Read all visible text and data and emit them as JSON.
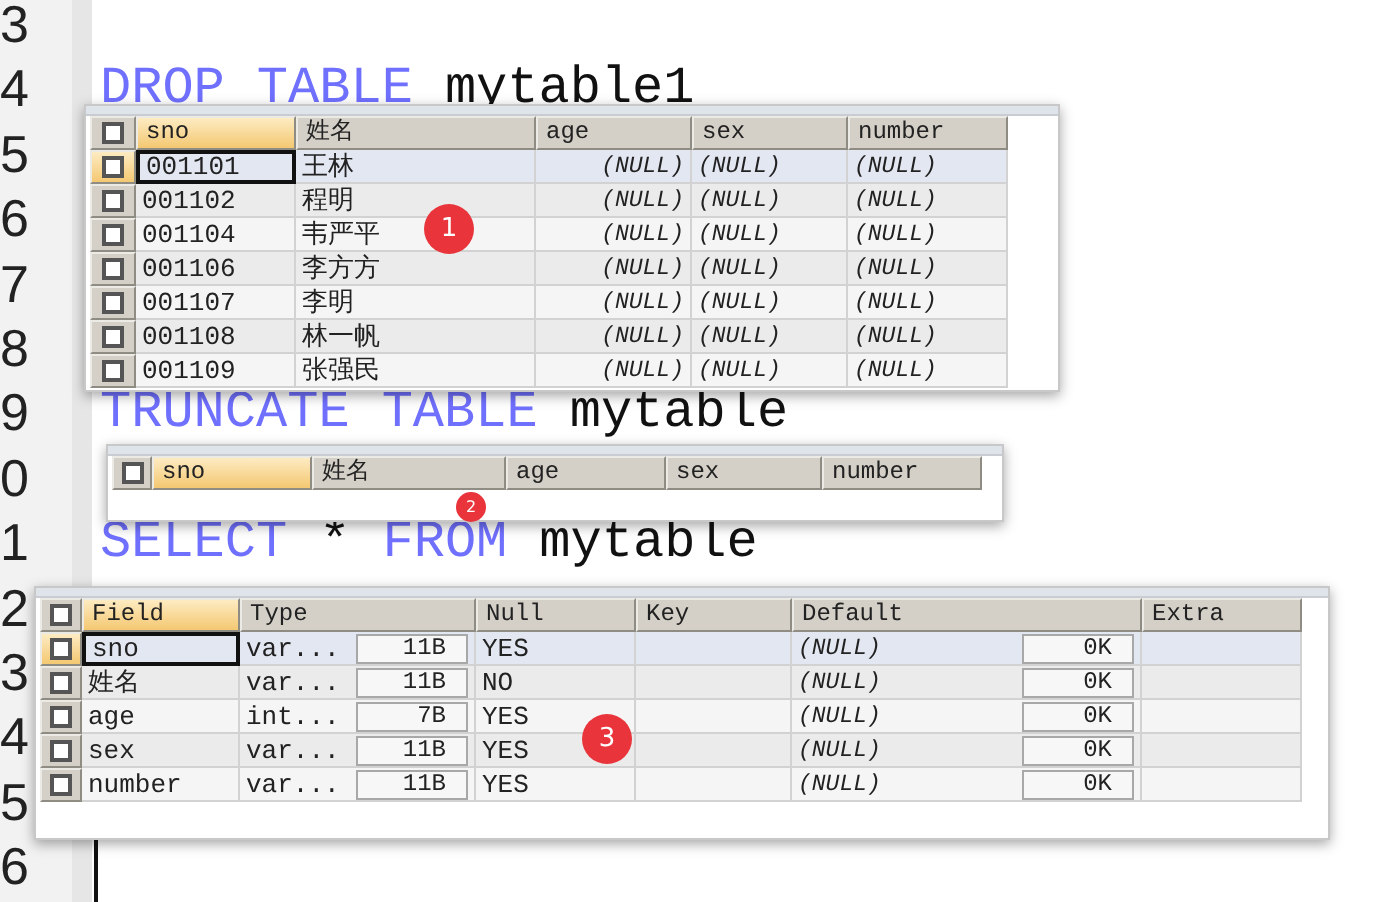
{
  "editor": {
    "lines": [
      {
        "number": "3"
      },
      {
        "number": "4",
        "tokens": [
          {
            "text": "DROP",
            "kind": "keyword"
          },
          {
            "text": "TABLE",
            "kind": "keyword"
          },
          {
            "text": "mytable1",
            "kind": "ident"
          }
        ]
      },
      {
        "number": "5"
      },
      {
        "number": "6"
      },
      {
        "number": "7"
      },
      {
        "number": "8"
      },
      {
        "number": "9",
        "tokens": [
          {
            "text": "TRUNCATE",
            "kind": "keyword"
          },
          {
            "text": "TABLE",
            "kind": "keyword"
          },
          {
            "text": "mytable",
            "kind": "ident"
          }
        ]
      },
      {
        "number": "0"
      },
      {
        "number": "1",
        "tokens": [
          {
            "text": "SELECT",
            "kind": "keyword"
          },
          {
            "text": "*",
            "kind": "ident"
          },
          {
            "text": "FROM",
            "kind": "keyword"
          },
          {
            "text": "mytable",
            "kind": "ident"
          }
        ]
      },
      {
        "number": "2"
      },
      {
        "number": "3"
      },
      {
        "number": "4"
      },
      {
        "number": "5"
      },
      {
        "number": "6"
      }
    ]
  },
  "results": [
    {
      "badge": "1",
      "all_checked": false,
      "columns": [
        {
          "label": "sno",
          "selected": true
        },
        {
          "label": "姓名",
          "selected": false
        },
        {
          "label": "age",
          "selected": false,
          "kind": "numeric"
        },
        {
          "label": "sex",
          "selected": false
        },
        {
          "label": "number",
          "selected": false
        }
      ],
      "rows": [
        {
          "selected": true,
          "checked": false,
          "cells": [
            {
              "text": "001101"
            },
            {
              "text": "王林"
            },
            {
              "text": "(NULL)",
              "null": true
            },
            {
              "text": "(NULL)",
              "null": true
            },
            {
              "text": "(NULL)",
              "null": true
            }
          ]
        },
        {
          "selected": false,
          "checked": false,
          "cells": [
            {
              "text": "001102"
            },
            {
              "text": "程明"
            },
            {
              "text": "(NULL)",
              "null": true
            },
            {
              "text": "(NULL)",
              "null": true
            },
            {
              "text": "(NULL)",
              "null": true
            }
          ]
        },
        {
          "selected": false,
          "checked": false,
          "cells": [
            {
              "text": "001104"
            },
            {
              "text": "韦严平"
            },
            {
              "text": "(NULL)",
              "null": true
            },
            {
              "text": "(NULL)",
              "null": true
            },
            {
              "text": "(NULL)",
              "null": true
            }
          ]
        },
        {
          "selected": false,
          "checked": false,
          "cells": [
            {
              "text": "001106"
            },
            {
              "text": "李方方"
            },
            {
              "text": "(NULL)",
              "null": true
            },
            {
              "text": "(NULL)",
              "null": true
            },
            {
              "text": "(NULL)",
              "null": true
            }
          ]
        },
        {
          "selected": false,
          "checked": false,
          "cells": [
            {
              "text": "001107"
            },
            {
              "text": "李明"
            },
            {
              "text": "(NULL)",
              "null": true
            },
            {
              "text": "(NULL)",
              "null": true
            },
            {
              "text": "(NULL)",
              "null": true
            }
          ]
        },
        {
          "selected": false,
          "checked": false,
          "cells": [
            {
              "text": "001108"
            },
            {
              "text": "林一帆"
            },
            {
              "text": "(NULL)",
              "null": true
            },
            {
              "text": "(NULL)",
              "null": true
            },
            {
              "text": "(NULL)",
              "null": true
            }
          ]
        },
        {
          "selected": false,
          "checked": false,
          "cells": [
            {
              "text": "001109"
            },
            {
              "text": "张强民"
            },
            {
              "text": "(NULL)",
              "null": true
            },
            {
              "text": "(NULL)",
              "null": true
            },
            {
              "text": "(NULL)",
              "null": true
            }
          ]
        }
      ]
    },
    {
      "badge": "2",
      "all_checked": false,
      "columns": [
        {
          "label": "sno",
          "selected": true
        },
        {
          "label": "姓名",
          "selected": false
        },
        {
          "label": "age",
          "selected": false
        },
        {
          "label": "sex",
          "selected": false
        },
        {
          "label": "number",
          "selected": false
        }
      ]
    },
    {
      "badge": "3",
      "all_checked": false,
      "columns": [
        {
          "label": "Field",
          "selected": true
        },
        {
          "label": "Type",
          "selected": false
        },
        {
          "label": "Null",
          "selected": false
        },
        {
          "label": "Key",
          "selected": false
        },
        {
          "label": "Default",
          "selected": false
        },
        {
          "label": "Extra",
          "selected": false
        }
      ],
      "rows": [
        {
          "selected": true,
          "checked": false,
          "cells": [
            {
              "text": "sno"
            },
            {
              "text": "var...",
              "size": "11B"
            },
            {
              "text": "YES"
            },
            {},
            {
              "text": "(NULL)",
              "null": true,
              "size": "0K"
            },
            {}
          ]
        },
        {
          "selected": false,
          "checked": false,
          "cells": [
            {
              "text": "姓名"
            },
            {
              "text": "var...",
              "size": "11B"
            },
            {
              "text": "NO"
            },
            {},
            {
              "text": "(NULL)",
              "null": true,
              "size": "0K"
            },
            {}
          ]
        },
        {
          "selected": false,
          "checked": false,
          "cells": [
            {
              "text": "age"
            },
            {
              "text": "int...",
              "size": "7B"
            },
            {
              "text": "YES"
            },
            {},
            {
              "text": "(NULL)",
              "null": true,
              "size": "0K"
            },
            {}
          ]
        },
        {
          "selected": false,
          "checked": false,
          "cells": [
            {
              "text": "sex"
            },
            {
              "text": "var...",
              "size": "11B"
            },
            {
              "text": "YES"
            },
            {},
            {
              "text": "(NULL)",
              "null": true,
              "size": "0K"
            },
            {}
          ]
        },
        {
          "selected": false,
          "checked": false,
          "cells": [
            {
              "text": "number"
            },
            {
              "text": "var...",
              "size": "11B"
            },
            {
              "text": "YES"
            },
            {},
            {
              "text": "(NULL)",
              "null": true,
              "size": "0K"
            },
            {}
          ]
        }
      ]
    }
  ]
}
